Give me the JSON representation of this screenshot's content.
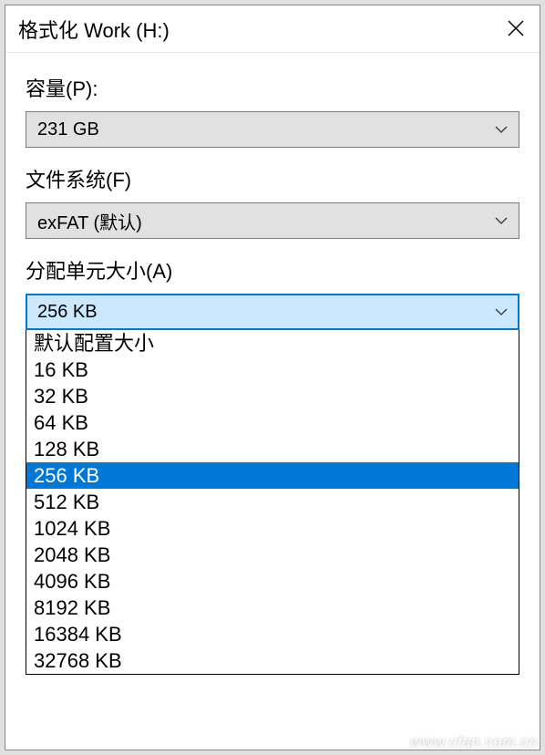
{
  "window": {
    "title": "格式化 Work (H:)"
  },
  "capacity": {
    "label": "容量(P):",
    "value": "231 GB"
  },
  "filesystem": {
    "label": "文件系统(F)",
    "value": "exFAT (默认)"
  },
  "alloc": {
    "label": "分配单元大小(A)",
    "value": "256 KB",
    "options": [
      "默认配置大小",
      "16 KB",
      "32 KB",
      "64 KB",
      "128 KB",
      "256 KB",
      "512 KB",
      "1024 KB",
      "2048 KB",
      "4096 KB",
      "8192 KB",
      "16384 KB",
      "32768 KB"
    ],
    "selected_index": 5
  },
  "watermark": "www.cfan.com.cn"
}
